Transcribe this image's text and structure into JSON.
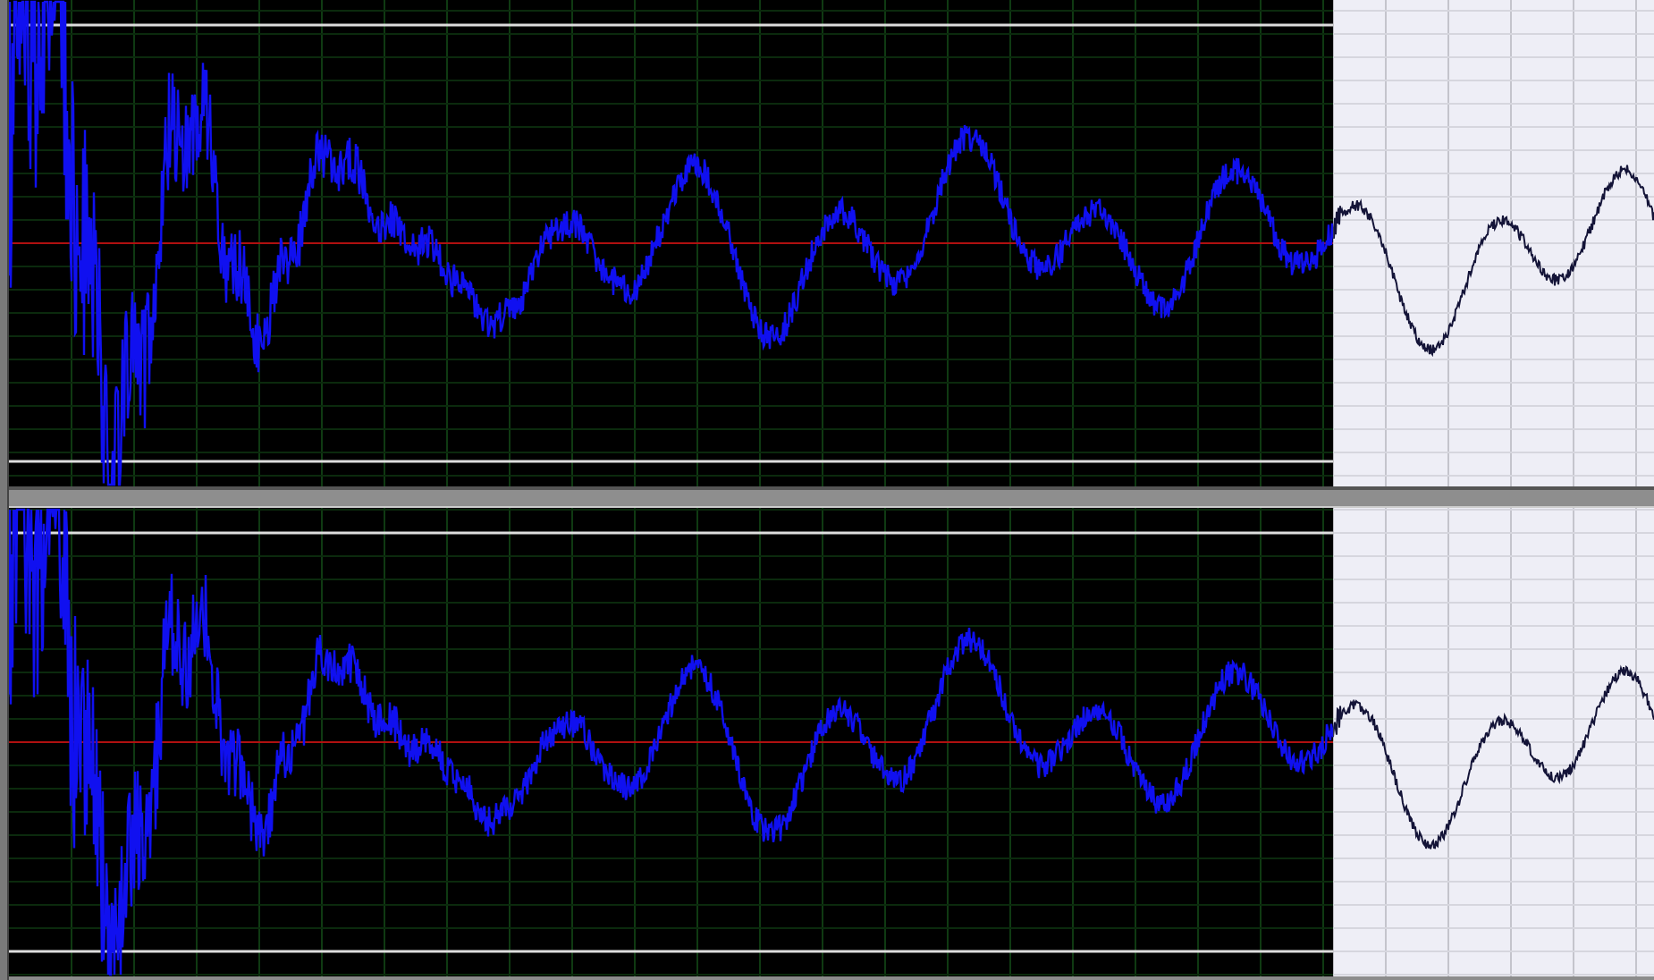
{
  "selection": {
    "level": 0.805
  },
  "channels": [
    {
      "kind": "wave"
    },
    {
      "kind": "wave"
    }
  ]
}
